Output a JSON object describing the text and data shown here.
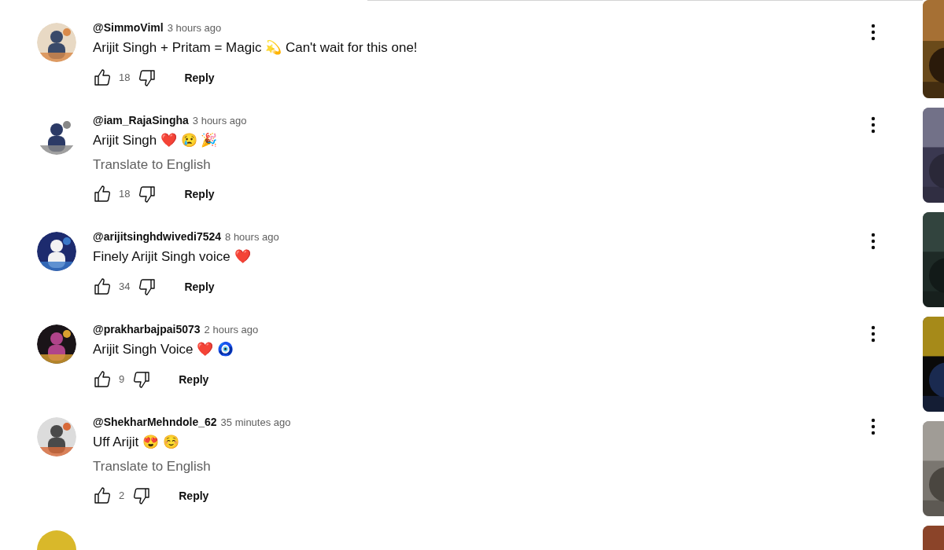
{
  "comments": [
    {
      "author": "@SimmoViml",
      "time": "3 hours ago",
      "text": "Arijit Singh + Pritam = Magic 💫 Can't wait for this one!",
      "likes": "18",
      "reply": "Reply"
    },
    {
      "author": "@iam_RajaSingha",
      "time": "3 hours ago",
      "text": "Arijit Singh ❤️ 😢 🎉",
      "translate": "Translate to English",
      "likes": "18",
      "reply": "Reply"
    },
    {
      "author": "@arijitsinghdwivedi7524",
      "time": "8 hours ago",
      "text": "Finely Arijit Singh voice ❤️",
      "likes": "34",
      "reply": "Reply"
    },
    {
      "author": "@prakharbajpai5073",
      "time": "2 hours ago",
      "text": "Arijit Singh Voice ❤️ 🧿",
      "likes": "9",
      "reply": "Reply"
    },
    {
      "author": "@ShekharMehndole_62",
      "time": "35 minutes ago",
      "text": "Uff Arijit 😍 ☺️",
      "translate": "Translate to English",
      "likes": "2",
      "reply": "Reply"
    }
  ]
}
